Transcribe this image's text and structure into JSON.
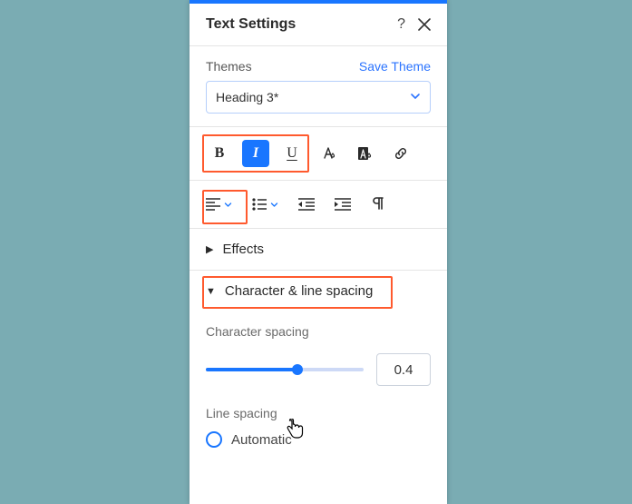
{
  "header": {
    "title": "Text Settings",
    "help_tooltip": "?",
    "close_tooltip": "Close"
  },
  "themes": {
    "label": "Themes",
    "save_link": "Save Theme",
    "selected": "Heading 3*"
  },
  "format": {
    "bold": "B",
    "italic": "I",
    "underline": "U"
  },
  "accordion": {
    "effects": "Effects",
    "char_line": "Character & line spacing"
  },
  "char_spacing": {
    "label": "Character spacing",
    "value": "0.4"
  },
  "line_spacing": {
    "label": "Line spacing",
    "option_auto": "Automatic"
  }
}
